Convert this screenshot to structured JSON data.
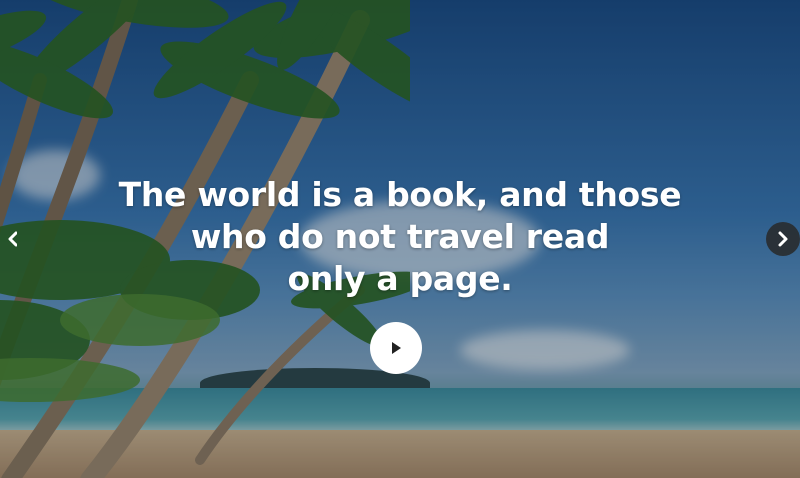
{
  "hero": {
    "quote_lines": [
      "The world is a book, and those",
      "who do not travel read",
      "only a page."
    ],
    "play_button": {
      "icon": "play-icon"
    },
    "prev_button": {
      "icon": "chevron-left-icon"
    },
    "next_button": {
      "icon": "chevron-right-icon"
    }
  },
  "colors": {
    "text": "#ffffff",
    "button_bg": "#ffffff",
    "arrow_bg": "#282828"
  }
}
